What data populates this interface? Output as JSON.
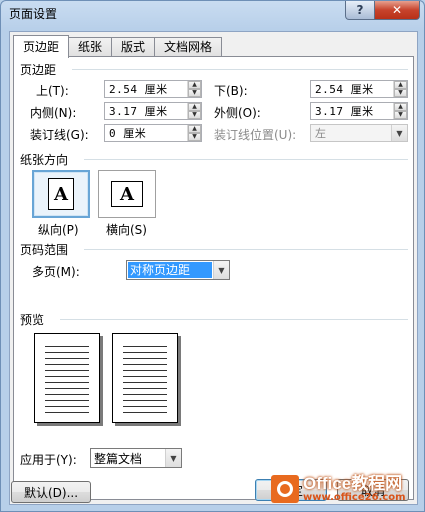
{
  "window": {
    "title": "页面设置"
  },
  "title_buttons": {
    "help": "?",
    "close": "✕"
  },
  "tabs": [
    {
      "label": "页边距",
      "active": true
    },
    {
      "label": "纸张",
      "active": false
    },
    {
      "label": "版式",
      "active": false
    },
    {
      "label": "文档网格",
      "active": false
    }
  ],
  "margins": {
    "section": "页边距",
    "top": {
      "label": "上(T):",
      "value": "2.54 厘米"
    },
    "bottom": {
      "label": "下(B):",
      "value": "2.54 厘米"
    },
    "inside": {
      "label": "内侧(N):",
      "value": "3.17 厘米"
    },
    "outside": {
      "label": "外侧(O):",
      "value": "3.17 厘米"
    },
    "gutter": {
      "label": "装订线(G):",
      "value": "0 厘米"
    },
    "gutter_position": {
      "label": "装订线位置(U):",
      "value": "左"
    }
  },
  "orientation": {
    "section": "纸张方向",
    "portrait": {
      "label": "纵向(P)",
      "glyph": "A",
      "selected": true
    },
    "landscape": {
      "label": "横向(S)",
      "glyph": "A",
      "selected": false
    }
  },
  "pages": {
    "section": "页码范围",
    "multiple_label": "多页(M):",
    "multiple_value": "对称页边距"
  },
  "preview": {
    "section": "预览"
  },
  "apply": {
    "label": "应用于(Y):",
    "value": "整篇文档"
  },
  "buttons": {
    "default": "默认(D)...",
    "ok": "确定",
    "cancel": "取消"
  },
  "watermark": {
    "brand": "Office",
    "brand_cn": "教程网",
    "url": "www.office26.com"
  }
}
